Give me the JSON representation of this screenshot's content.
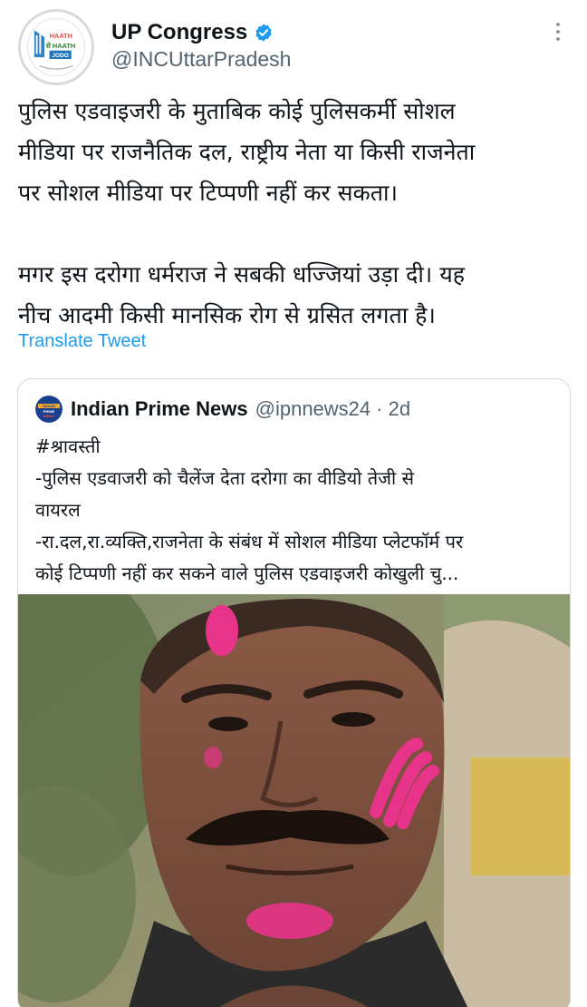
{
  "tweet": {
    "author": {
      "display_name": "UP Congress",
      "handle": "@INCUttarPradesh",
      "verified": true,
      "avatar_logo_text": [
        "HAATH",
        "से HAATH",
        "JODO"
      ]
    },
    "text_lines": [
      "पुलिस एडवाइजरी के मुताबिक कोई पुलिसकर्मी सोशल",
      "मीडिया पर राजनैतिक दल, राष्ट्रीय नेता या किसी राजनेता",
      "पर सोशल मीडिया पर टिप्पणी नहीं कर सकता।",
      "",
      "मगर इस दरोगा धर्मराज ने सबकी धज्जियां उड़ा दी। यह",
      "नीच आदमी किसी मानसिक रोग से ग्रसित लगता है।"
    ],
    "translate_label": "Translate Tweet",
    "more_icon": "more-options-icon"
  },
  "quoted_tweet": {
    "author": {
      "display_name": "Indian Prime News",
      "handle": "@ipnnews24",
      "time": "· 2d",
      "avatar_logo_text": [
        "INDIAN",
        "PRIME",
        "NEWS"
      ]
    },
    "text_lines": [
      "#श्रावस्ती",
      "-पुलिस एडवाजरी को चैलेंज देता दरोगा का वीडियो तेजी से",
      "वायरल",
      "-रा.दल,रा.व्यक्ति,राजनेता के संबंध में सोशल मीडिया प्लेटफॉर्म पर",
      "कोई टिप्पणी नहीं कर सकने वाले पुलिस एडवाइजरी कोखुली चु..."
    ],
    "media": {
      "kind": "video-thumbnail",
      "subject": "man-with-holi-colour-on-face"
    }
  },
  "colors": {
    "text_primary": "#0f1419",
    "text_secondary": "#536471",
    "link": "#1d9bf0",
    "verified": "#1d9bf0",
    "border": "#cfd9de",
    "holi_pink": "#e8338a"
  }
}
